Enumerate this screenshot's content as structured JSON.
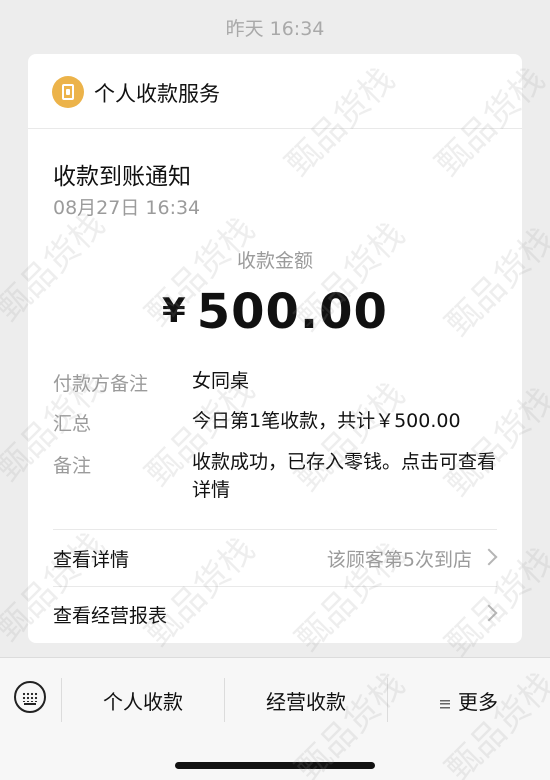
{
  "timestamp": "昨天 16:34",
  "card": {
    "service_name": "个人收款服务",
    "title": "收款到账通知",
    "time": "08月27日 16:34",
    "amount_label": "收款金额",
    "currency": "¥",
    "amount": "500.00",
    "details": [
      {
        "label": "付款方备注",
        "value": "女同桌"
      },
      {
        "label": "汇总",
        "value": "今日第1笔收款，共计￥500.00"
      },
      {
        "label": "备注",
        "value": "收款成功，已存入零钱。点击可查看详情"
      }
    ],
    "links": [
      {
        "label": "查看详情",
        "extra": "该顾客第5次到店"
      },
      {
        "label": "查看经营报表",
        "extra": ""
      }
    ]
  },
  "bottom_menu": {
    "items": [
      {
        "label": "个人收款"
      },
      {
        "label": "经营收款"
      },
      {
        "label": "更多"
      }
    ]
  },
  "watermark": "甄品货栈",
  "colors": {
    "background": "#ededed",
    "card": "#ffffff",
    "service_icon": "#ecb34a",
    "muted_text": "#9b9b9b"
  },
  "icons": {
    "service": "wallet-icon",
    "keyboard": "keyboard-icon",
    "more": "menu-icon",
    "chevron": "chevron-right-icon"
  }
}
